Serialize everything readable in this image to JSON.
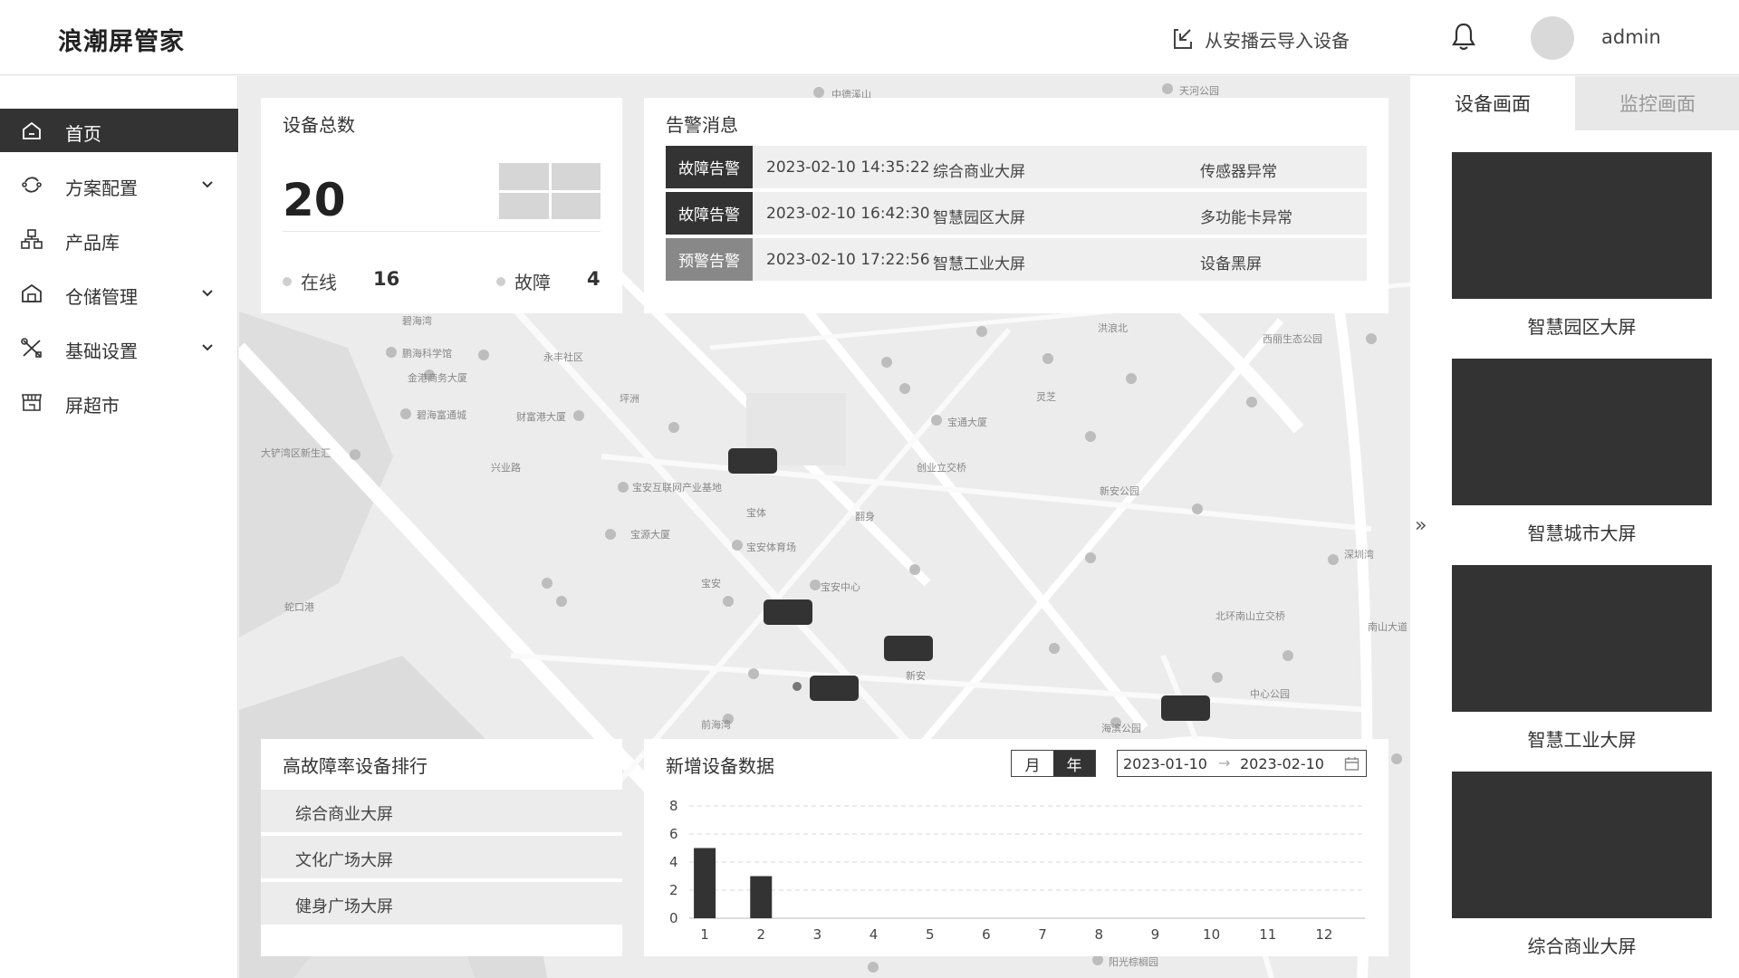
{
  "header": {
    "brand": "浪潮屏管家",
    "import_label": "从安播云导入设备",
    "username": "admin"
  },
  "sidebar": {
    "items": [
      {
        "label": "首页",
        "icon": "home-icon",
        "active": true,
        "expandable": false
      },
      {
        "label": "方案配置",
        "icon": "refresh-icon",
        "active": false,
        "expandable": true
      },
      {
        "label": "产品库",
        "icon": "hierarchy-icon",
        "active": false,
        "expandable": false
      },
      {
        "label": "仓储管理",
        "icon": "warehouse-icon",
        "active": false,
        "expandable": true
      },
      {
        "label": "基础设置",
        "icon": "tools-icon",
        "active": false,
        "expandable": true
      },
      {
        "label": "屏超市",
        "icon": "store-icon",
        "active": false,
        "expandable": false
      }
    ]
  },
  "device_total": {
    "title": "设备总数",
    "total": "20",
    "online_label": "在线",
    "online_count": "16",
    "fault_label": "故障",
    "fault_count": "4"
  },
  "alarms": {
    "title": "告警消息",
    "rows": [
      {
        "type": "故障告警",
        "level": "fault",
        "time": "2023-02-10  14:35:22",
        "device": "综合商业大屏",
        "message": "传感器异常"
      },
      {
        "type": "故障告警",
        "level": "fault",
        "time": "2023-02-10  16:42:30",
        "device": "智慧园区大屏",
        "message": "多功能卡异常"
      },
      {
        "type": "预警告警",
        "level": "warn",
        "time": "2023-02-10  17:22:56",
        "device": "智慧工业大屏",
        "message": "设备黑屏"
      }
    ]
  },
  "ranking": {
    "title": "高故障率设备排行",
    "items": [
      "综合商业大屏",
      "文化广场大屏",
      "健身广场大屏"
    ]
  },
  "new_devices": {
    "title": "新增设备数据",
    "toggle_month": "月",
    "toggle_year": "年",
    "date_start": "2023-01-10",
    "date_arrow": "→",
    "date_end": "2023-02-10"
  },
  "chart_data": {
    "type": "bar",
    "title": "新增设备数据",
    "categories": [
      "1",
      "2",
      "3",
      "4",
      "5",
      "6",
      "7",
      "8",
      "9",
      "10",
      "11",
      "12"
    ],
    "values": [
      5,
      3,
      0,
      0,
      0,
      0,
      0,
      0,
      0,
      0,
      0,
      0
    ],
    "yticks": [
      "0",
      "2",
      "4",
      "6",
      "8"
    ],
    "ylim": [
      0,
      8
    ],
    "grid": true,
    "color": "#333333"
  },
  "map": {
    "labels": [
      "中德溪山",
      "天河公园",
      "碧海湾",
      "鹏海科学馆",
      "永丰社区",
      "金港商务大厦",
      "坪洲",
      "碧海富通城",
      "财富港大厦",
      "大铲湾区新生汇",
      "兴业路",
      "宝安互联网产业基地",
      "宝体",
      "宝安体育场",
      "宝安中心",
      "宝源大厦",
      "宝安",
      "新安",
      "灵芝",
      "宝通大厦",
      "创业立交桥",
      "新安公园",
      "洪浪北",
      "西丽生态公园",
      "中心公园",
      "北环南山立交桥",
      "深圳湾",
      "翻身",
      "前海湾",
      "海滨公园",
      "阳光棕榈园",
      "南山大道",
      "蛇口港"
    ],
    "markers": [
      "智慧园区大屏",
      "智慧城市大屏",
      "智慧工业大屏",
      "综合商业大屏",
      "文化广场大屏"
    ]
  },
  "right_panel": {
    "tabs": [
      "设备画面",
      "监控画面"
    ],
    "collapse_label": "»",
    "screens": [
      "智慧园区大屏",
      "智慧城市大屏",
      "智慧工业大屏",
      "综合商业大屏"
    ]
  },
  "colors": {
    "accent_dark": "#333333",
    "warn_gray": "#888888",
    "map_bg": "#ececec"
  }
}
